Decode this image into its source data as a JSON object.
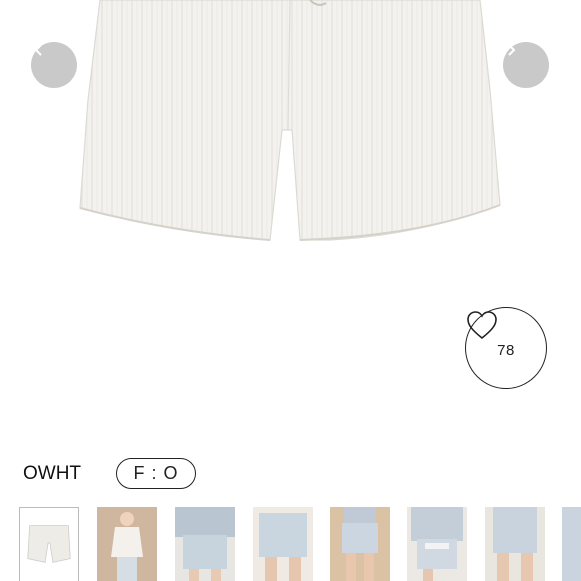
{
  "product": {
    "color_code": "OWHT",
    "size_label": "F : O",
    "likes": "78"
  },
  "carousel": {
    "prev_icon": "chevron-left-icon",
    "next_icon": "chevron-right-icon"
  },
  "thumbnails": [
    {
      "name": "thumbnail-1",
      "selected": true
    },
    {
      "name": "thumbnail-2",
      "selected": false
    },
    {
      "name": "thumbnail-3",
      "selected": false
    },
    {
      "name": "thumbnail-4",
      "selected": false
    },
    {
      "name": "thumbnail-5",
      "selected": false
    },
    {
      "name": "thumbnail-6",
      "selected": false
    },
    {
      "name": "thumbnail-7",
      "selected": false
    },
    {
      "name": "thumbnail-8",
      "selected": false
    }
  ]
}
